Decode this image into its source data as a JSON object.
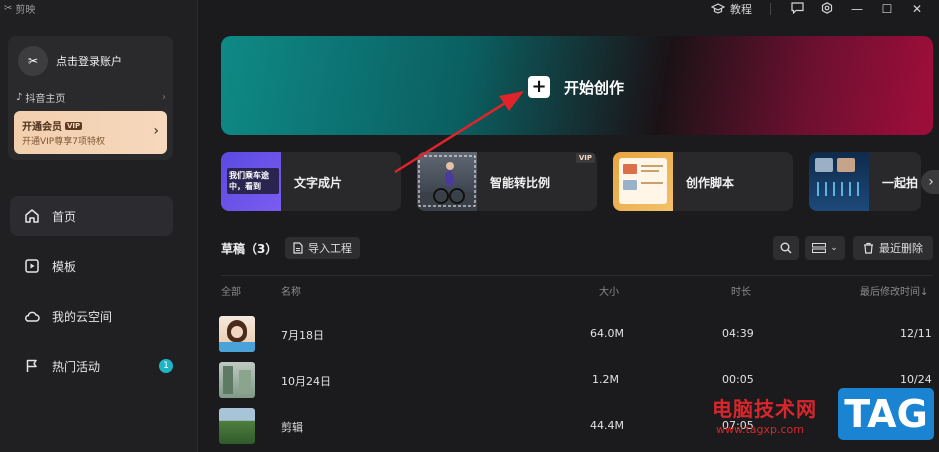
{
  "app": {
    "name": "剪映"
  },
  "account": {
    "login": "点击登录账户",
    "douyin": "抖音主页",
    "vip_title": "开通会员",
    "vip_badge": "VIP",
    "vip_sub": "开通VIP尊享7项特权"
  },
  "topbar": {
    "tutorial": "教程"
  },
  "nav": [
    {
      "label": "首页",
      "icon": "home-icon"
    },
    {
      "label": "模板",
      "icon": "template-icon"
    },
    {
      "label": "我的云空间",
      "icon": "cloud-icon"
    },
    {
      "label": "热门活动",
      "icon": "flag-icon",
      "badge": "1"
    }
  ],
  "hero": {
    "label": "开始创作"
  },
  "features": [
    {
      "label": "文字成片",
      "thumb_text": "我们乘车途中，看到",
      "vip": ""
    },
    {
      "label": "智能转比例",
      "vip": "VIP"
    },
    {
      "label": "创作脚本",
      "vip": ""
    },
    {
      "label": "一起拍",
      "vip": ""
    }
  ],
  "drafts": {
    "title": "草稿",
    "count": "（3）",
    "import_label": "导入工程",
    "recent_delete": "最近删除",
    "columns": {
      "all": "全部",
      "name": "名称",
      "size": "大小",
      "duration": "时长",
      "modified": "最后修改时间↓"
    },
    "rows": [
      {
        "name": "7月18日",
        "size": "64.0M",
        "duration": "04:39",
        "modified": "12/11"
      },
      {
        "name": "10月24日",
        "size": "1.2M",
        "duration": "00:05",
        "modified": "10/24"
      },
      {
        "name": "剪辑",
        "size": "44.4M",
        "duration": "07:05",
        "modified": ""
      }
    ]
  },
  "watermark": {
    "text": "电脑技术网",
    "url": "www.tagxp.com",
    "tag": "TAG"
  },
  "colors": {
    "accent": "#1fb4c4",
    "arrow": "#e0242a",
    "vip_card": "#f3cfae"
  }
}
